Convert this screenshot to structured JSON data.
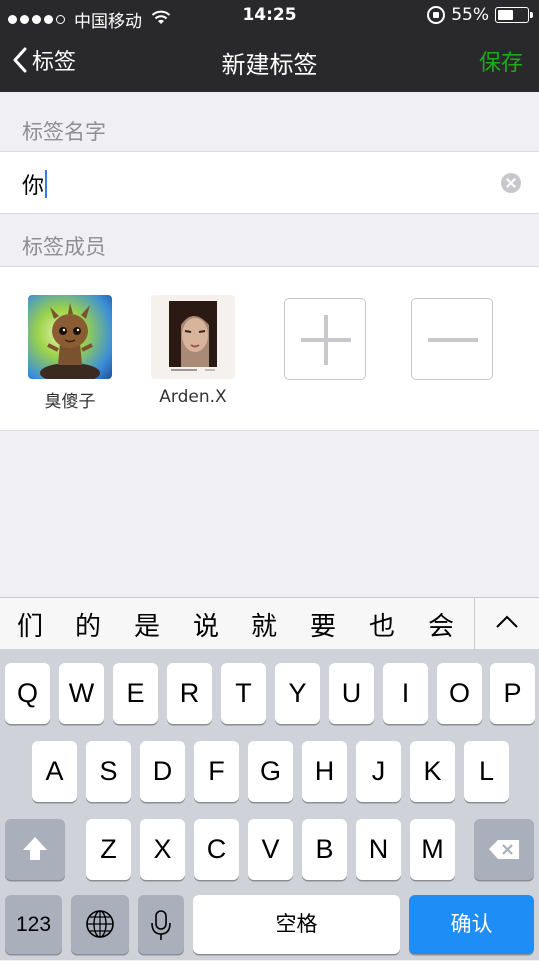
{
  "status_bar": {
    "carrier": "中国移动",
    "time": "14:25",
    "battery_percent": "55%",
    "battery_level": 0.55
  },
  "nav": {
    "back_label": "标签",
    "title": "新建标签",
    "save_label": "保存"
  },
  "tag_name": {
    "section_label": "标签名字",
    "value": "你"
  },
  "members": {
    "section_label": "标签成员",
    "items": [
      {
        "name": "臭傻子"
      },
      {
        "name": "Arden.X"
      }
    ]
  },
  "keyboard": {
    "candidates": [
      "们",
      "的",
      "是",
      "说",
      "就",
      "要",
      "也",
      "会"
    ],
    "row1": [
      "Q",
      "W",
      "E",
      "R",
      "T",
      "Y",
      "U",
      "I",
      "O",
      "P"
    ],
    "row2": [
      "A",
      "S",
      "D",
      "F",
      "G",
      "H",
      "J",
      "K",
      "L"
    ],
    "row3": [
      "Z",
      "X",
      "C",
      "V",
      "B",
      "N",
      "M"
    ],
    "numbers_label": "123",
    "space_label": "空格",
    "confirm_label": "确认"
  },
  "colors": {
    "accent_green": "#1aad19",
    "nav_bg": "#29292b",
    "confirm_blue": "#1e8df5"
  }
}
